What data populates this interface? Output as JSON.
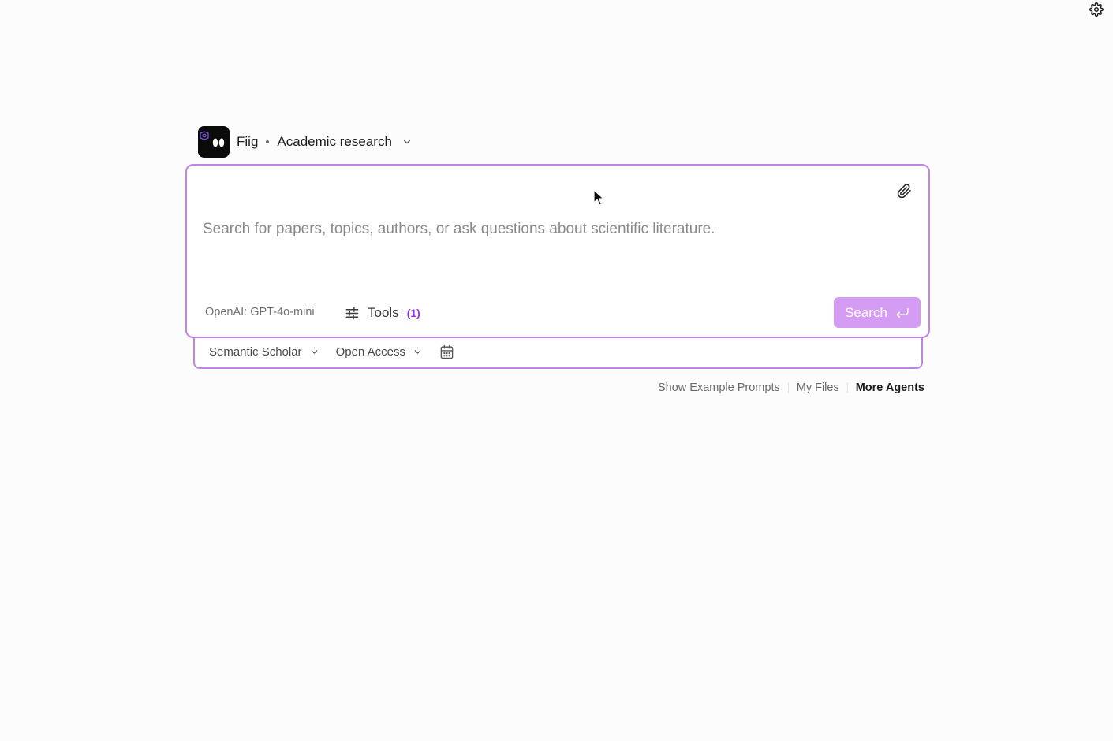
{
  "icons": {
    "settings": "gear-icon",
    "logo": "fiig-logo",
    "mode_dropdown": "chevron-down-icon",
    "attach": "paperclip-icon",
    "tools": "sliders-icon",
    "search_submit": "enter-icon",
    "date_filter": "calendar-icon"
  },
  "colors": {
    "accent_border": "#c084e8",
    "search_button_bg": "#d59cf3",
    "tools_count": "#9333ea",
    "background": "#fdfcfd"
  },
  "header": {
    "agent_name": "Fiig",
    "mode": "Academic research"
  },
  "search": {
    "value": "",
    "placeholder": "Search for papers, topics, authors, or ask questions about scientific literature.",
    "model": "OpenAI: GPT-4o-mini",
    "tools_label": "Tools",
    "tools_count": "(1)",
    "submit_label": "Search"
  },
  "filters": {
    "source": "Semantic Scholar",
    "access": "Open Access"
  },
  "footer": {
    "example_prompts": "Show Example Prompts",
    "my_files": "My Files",
    "more_agents": "More Agents"
  }
}
